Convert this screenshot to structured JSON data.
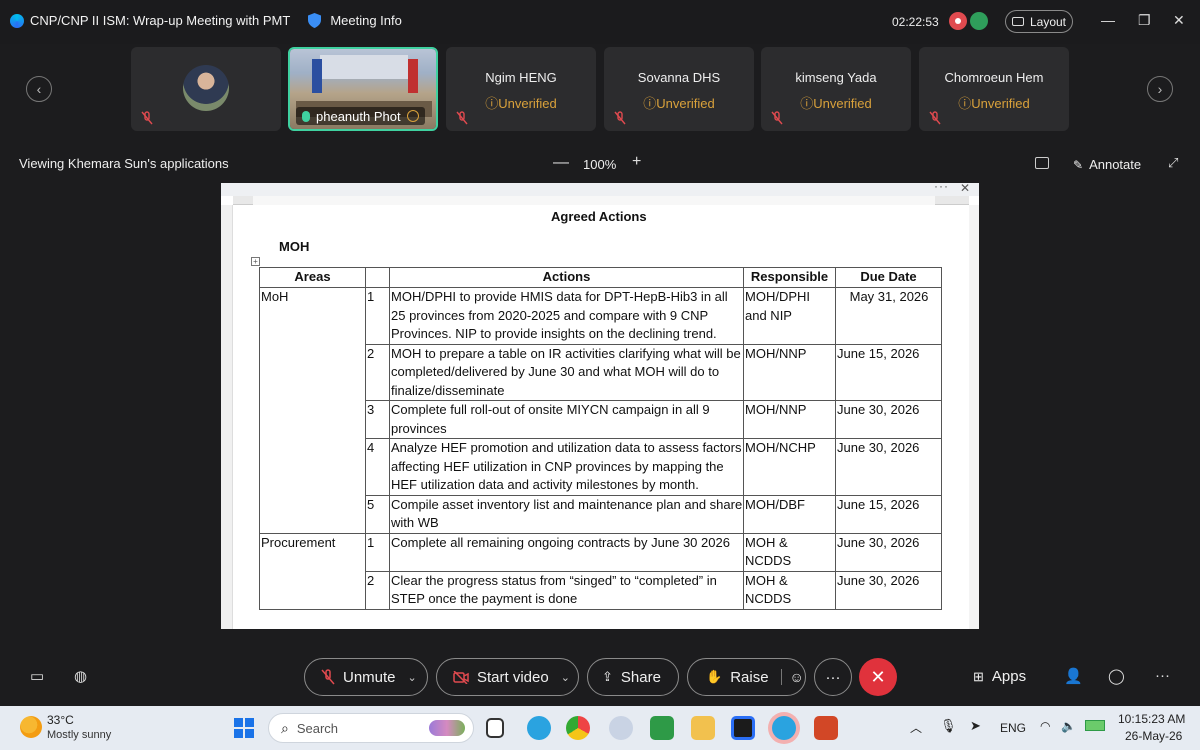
{
  "window": {
    "title": "CNP/CNP II ISM: Wrap-up Meeting with PMT",
    "meeting_info": "Meeting Info",
    "elapsed": "02:22:53",
    "layout_label": "Layout"
  },
  "participants": [
    {
      "name": "",
      "status": "",
      "muted": true
    },
    {
      "name": "pheanuth Phot",
      "status": "",
      "active": true
    },
    {
      "name": "Ngim HENG",
      "status": "Unverified",
      "muted": true
    },
    {
      "name": "Sovanna DHS",
      "status": "Unverified",
      "muted": true
    },
    {
      "name": "kimseng Yada",
      "status": "Unverified",
      "muted": true
    },
    {
      "name": "Chomroeun Hem",
      "status": "Unverified",
      "muted": true
    }
  ],
  "share": {
    "viewing_label": "Viewing Khemara Sun's applications",
    "zoom": "100%",
    "annotate_label": "Annotate"
  },
  "document": {
    "heading": "Agreed Actions",
    "section": "MOH",
    "table": {
      "headers": [
        "Areas",
        "",
        "Actions",
        "Responsible",
        "Due Date"
      ],
      "rows": [
        {
          "area": "MoH",
          "num": "1",
          "action": "MOH/DPHI to provide HMIS data for DPT-HepB-Hib3 in all 25 provinces from 2020-2025 and compare with 9 CNP Provinces. NIP to provide insights on the declining trend.",
          "responsible": "MOH/DPHI and NIP",
          "due": "May 31, 2026"
        },
        {
          "area": "",
          "num": "2",
          "action": "MOH to prepare a table on IR activities clarifying what will be completed/delivered by June 30 and what MOH will do to finalize/disseminate",
          "responsible": "MOH/NNP",
          "due": "June 15, 2026"
        },
        {
          "area": "",
          "num": "3",
          "action": "Complete full roll-out of onsite MIYCN campaign in all 9 provinces",
          "responsible": "MOH/NNP",
          "due": "June 30, 2026"
        },
        {
          "area": "",
          "num": "4",
          "action": "Analyze HEF promotion and utilization data to assess factors affecting HEF utilization in CNP provinces by mapping the HEF utilization data and activity milestones by month.",
          "responsible": "MOH/NCHP",
          "due": "June 30, 2026"
        },
        {
          "area": "",
          "num": "5",
          "action": "Compile asset inventory list and maintenance plan and share with WB",
          "responsible": "MOH/DBF",
          "due": "June 15, 2026"
        },
        {
          "area": "Procurement",
          "num": "1",
          "action": "Complete all remaining ongoing contracts by June 30 2026",
          "responsible": "MOH & NCDDS",
          "due": "June 30, 2026"
        },
        {
          "area": "",
          "num": "2",
          "action": "Clear the progress status from “singed” to “completed” in STEP once the payment is done",
          "responsible": "MOH & NCDDS",
          "due": "June 30, 2026"
        }
      ]
    }
  },
  "controls": {
    "unmute": "Unmute",
    "start_video": "Start video",
    "share": "Share",
    "raise": "Raise",
    "more": "···",
    "apps": "Apps"
  },
  "taskbar": {
    "temperature": "33°C",
    "weather": "Mostly sunny",
    "search_placeholder": "Search",
    "language": "ENG",
    "time": "10:15:23 AM",
    "date": "26-May-26"
  },
  "colors": {
    "accent_active": "#3fd1a0",
    "unverified": "#d9a13b",
    "end_call": "#e0323c"
  }
}
